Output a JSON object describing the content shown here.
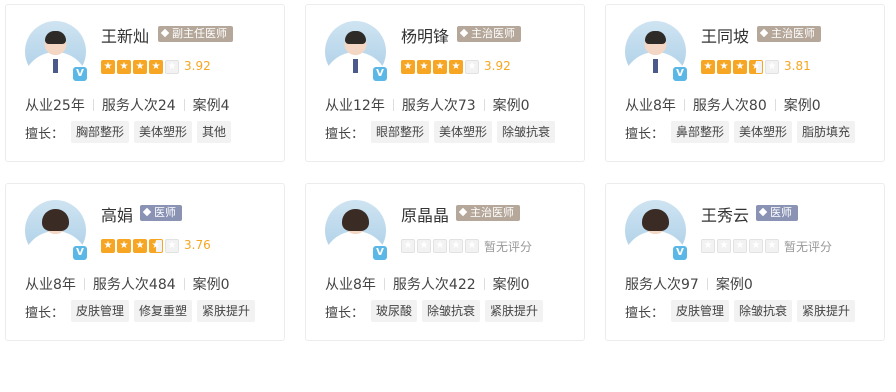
{
  "doctors": [
    {
      "name": "王新灿",
      "title": "副主任医师",
      "rating": 3.92,
      "score_text": "3.92",
      "stats": [
        "从业25年",
        "服务人次24",
        "案例4"
      ],
      "skills_label": "擅长：",
      "skills": [
        "胸部整形",
        "美体塑形",
        "其他"
      ]
    },
    {
      "name": "杨明锋",
      "title": "主治医师",
      "rating": 3.92,
      "score_text": "3.92",
      "stats": [
        "从业12年",
        "服务人次73",
        "案例0"
      ],
      "skills_label": "擅长：",
      "skills": [
        "眼部整形",
        "美体塑形",
        "除皱抗衰"
      ]
    },
    {
      "name": "王同坡",
      "title": "主治医师",
      "rating": 3.81,
      "score_text": "3.81",
      "stats": [
        "从业8年",
        "服务人次80",
        "案例0"
      ],
      "skills_label": "擅长：",
      "skills": [
        "鼻部整形",
        "美体塑形",
        "脂肪填充"
      ]
    },
    {
      "name": "高娟",
      "title": "医师",
      "rating": 3.76,
      "score_text": "3.76",
      "stats": [
        "从业8年",
        "服务人次484",
        "案例0"
      ],
      "skills_label": "擅长：",
      "skills": [
        "皮肤管理",
        "修复重塑",
        "紧肤提升"
      ]
    },
    {
      "name": "原晶晶",
      "title": "主治医师",
      "rating": 0,
      "score_text": "暂无评分",
      "stats": [
        "从业8年",
        "服务人次422",
        "案例0"
      ],
      "skills_label": "擅长：",
      "skills": [
        "玻尿酸",
        "除皱抗衰",
        "紧肤提升"
      ]
    },
    {
      "name": "王秀云",
      "title": "医师",
      "rating": 0,
      "score_text": "暂无评分",
      "stats": [
        "服务人次97",
        "案例0"
      ],
      "skills_label": "擅长：",
      "skills": [
        "皮肤管理",
        "除皱抗衰",
        "紧肤提升"
      ]
    }
  ],
  "verified_mark": "V",
  "colors": {
    "star": "#f6a623",
    "title_tag": "#b5a79a",
    "title_tag_doctor": "#8a93b4",
    "verified": "#5bb8e6"
  }
}
